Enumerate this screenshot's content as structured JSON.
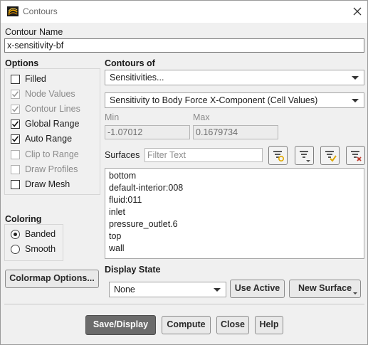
{
  "window": {
    "title": "Contours"
  },
  "contour_name": {
    "label": "Contour Name",
    "value": "x-sensitivity-bf"
  },
  "options": {
    "label": "Options",
    "items": [
      {
        "label": "Filled",
        "checked": false,
        "enabled": true
      },
      {
        "label": "Node Values",
        "checked": true,
        "enabled": false
      },
      {
        "label": "Contour Lines",
        "checked": true,
        "enabled": false
      },
      {
        "label": "Global Range",
        "checked": true,
        "enabled": true
      },
      {
        "label": "Auto Range",
        "checked": true,
        "enabled": true
      },
      {
        "label": "Clip to Range",
        "checked": false,
        "enabled": false
      },
      {
        "label": "Draw Profiles",
        "checked": false,
        "enabled": false
      },
      {
        "label": "Draw Mesh",
        "checked": false,
        "enabled": true
      }
    ]
  },
  "coloring": {
    "label": "Coloring",
    "options": [
      {
        "label": "Banded",
        "selected": true
      },
      {
        "label": "Smooth",
        "selected": false
      }
    ]
  },
  "colormap_button": "Colormap Options...",
  "contours_of": {
    "label": "Contours of",
    "category": "Sensitivities...",
    "quantity": "Sensitivity to Body Force X-Component (Cell Values)",
    "min_label": "Min",
    "min_value": "-1.07012",
    "max_label": "Max",
    "max_value": "0.1679734"
  },
  "surfaces": {
    "label": "Surfaces",
    "filter_placeholder": "Filter Text",
    "items": [
      "bottom",
      "default-interior:008",
      "fluid:011",
      "inlet",
      "pressure_outlet.6",
      "top",
      "wall"
    ]
  },
  "display_state": {
    "label": "Display State",
    "value": "None",
    "use_active": "Use Active",
    "new_surface": "New Surface"
  },
  "footer": {
    "save_display": "Save/Display",
    "compute": "Compute",
    "close": "Close",
    "help": "Help"
  },
  "colors": {
    "primary_button": "#6b6b6b",
    "accent_yellow": "#e0a800",
    "accent_red": "#c0392b"
  }
}
